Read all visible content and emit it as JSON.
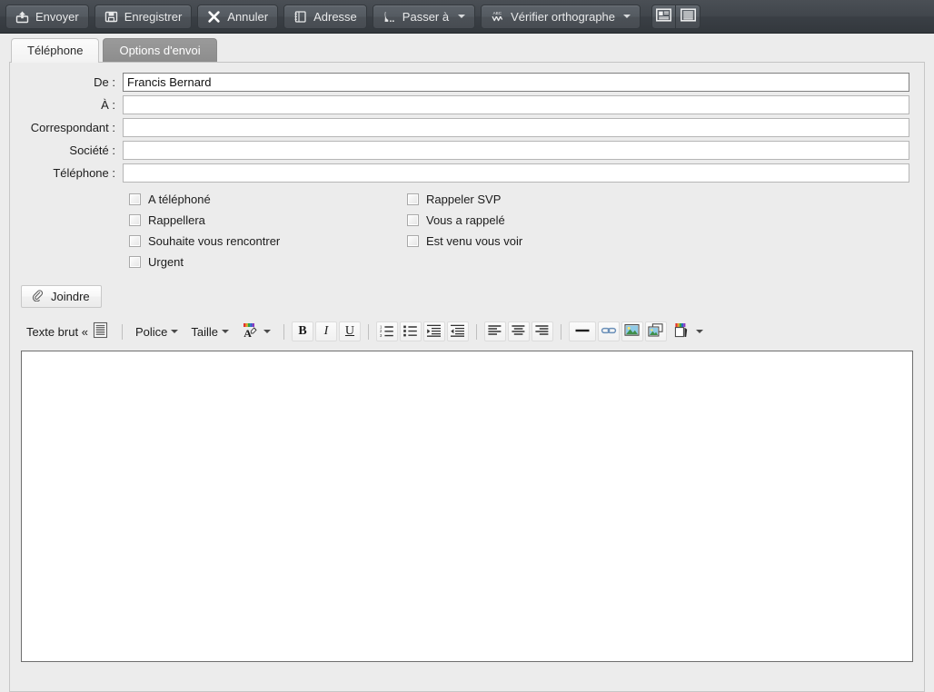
{
  "toolbar": {
    "buttons": [
      {
        "label": "Envoyer",
        "icon": "send-upload-icon",
        "dropdown": false
      },
      {
        "label": "Enregistrer",
        "icon": "floppy-save-icon",
        "dropdown": false
      },
      {
        "label": "Annuler",
        "icon": "x-cancel-icon",
        "dropdown": false
      },
      {
        "label": "Adresse",
        "icon": "address-book-icon",
        "dropdown": false
      },
      {
        "label": "Passer à",
        "icon": "move-to-icon",
        "dropdown": true
      },
      {
        "label": "Vérifier orthographe",
        "icon": "spellcheck-abc-icon",
        "dropdown": true
      }
    ],
    "view_buttons": [
      {
        "name": "reading-pane-right-icon"
      },
      {
        "name": "reading-pane-off-icon"
      }
    ]
  },
  "tabs": [
    {
      "label": "Téléphone",
      "active": true
    },
    {
      "label": "Options d'envoi",
      "active": false
    }
  ],
  "form": {
    "fields": [
      {
        "label": "De :",
        "value": "Francis Bernard",
        "placeholder": "",
        "primary": true
      },
      {
        "label": "À :",
        "value": "",
        "placeholder": "",
        "primary": false
      },
      {
        "label": "Correspondant :",
        "value": "",
        "placeholder": "",
        "primary": false
      },
      {
        "label": "Société :",
        "value": "",
        "placeholder": "",
        "primary": false
      },
      {
        "label": "Téléphone :",
        "value": "",
        "placeholder": "",
        "primary": false
      }
    ],
    "checkboxes_left": [
      {
        "label": "A téléphoné",
        "checked": false
      },
      {
        "label": "Rappellera",
        "checked": false
      },
      {
        "label": "Souhaite vous rencontrer",
        "checked": false
      },
      {
        "label": "Urgent",
        "checked": false
      }
    ],
    "checkboxes_right": [
      {
        "label": "Rappeler SVP",
        "checked": false
      },
      {
        "label": "Vous a rappelé",
        "checked": false
      },
      {
        "label": "Est venu vous voir",
        "checked": false
      }
    ],
    "attach_label": "Joindre",
    "attach_icon": "paperclip-icon"
  },
  "editor": {
    "format_mode_label": "Texte brut «",
    "format_mode_icon": "document-lines-icon",
    "font_label": "Police",
    "size_label": "Taille",
    "font_color_icon": "font-color-a-icon",
    "buttons": [
      {
        "name": "bold-button",
        "glyph": "B"
      },
      {
        "name": "italic-button",
        "glyph": "I"
      },
      {
        "name": "underline-button",
        "glyph": "U"
      },
      {
        "name": "numbered-list-button",
        "glyph": ""
      },
      {
        "name": "bulleted-list-button",
        "glyph": ""
      },
      {
        "name": "indent-increase-button",
        "glyph": ""
      },
      {
        "name": "indent-decrease-button",
        "glyph": ""
      },
      {
        "name": "align-left-button",
        "glyph": ""
      },
      {
        "name": "align-center-button",
        "glyph": ""
      },
      {
        "name": "align-right-button",
        "glyph": ""
      },
      {
        "name": "horizontal-rule-button",
        "glyph": ""
      },
      {
        "name": "insert-link-button",
        "glyph": ""
      },
      {
        "name": "insert-image-button",
        "glyph": ""
      },
      {
        "name": "insert-image-copy-button",
        "glyph": ""
      },
      {
        "name": "highlight-color-button",
        "glyph": ""
      }
    ],
    "body_value": "",
    "body_placeholder": ""
  },
  "colors": {
    "toolbar_dark": "#41464c",
    "panel_bg": "#ececec",
    "tab_active_bg": "#f7f7f7",
    "tab_inactive_bg": "#939393",
    "field_border": "#b6b6b6",
    "field_border_primary": "#808080",
    "editor_border": "#6e6e6e"
  }
}
